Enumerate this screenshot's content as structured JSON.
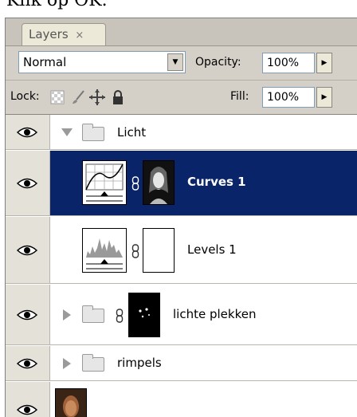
{
  "caption": "Klik op OK.",
  "panel": {
    "tab_label": "Layers",
    "tab_close": "×",
    "blend_mode": "Normal",
    "opacity_label": "Opacity:",
    "opacity_value": "100%",
    "lock_label": "Lock:",
    "fill_label": "Fill:",
    "fill_value": "100%"
  },
  "layers": [
    {
      "name": "Licht",
      "type": "group",
      "expanded": true
    },
    {
      "name": "Curves 1",
      "type": "adjustment-curves",
      "selected": true
    },
    {
      "name": "Levels 1",
      "type": "adjustment-levels"
    },
    {
      "name": "lichte plekken",
      "type": "group",
      "expanded": false
    },
    {
      "name": "rimpels",
      "type": "group",
      "expanded": false
    }
  ],
  "colors": {
    "selection": "#0a246a",
    "panel_bg": "#d4d0c8"
  }
}
